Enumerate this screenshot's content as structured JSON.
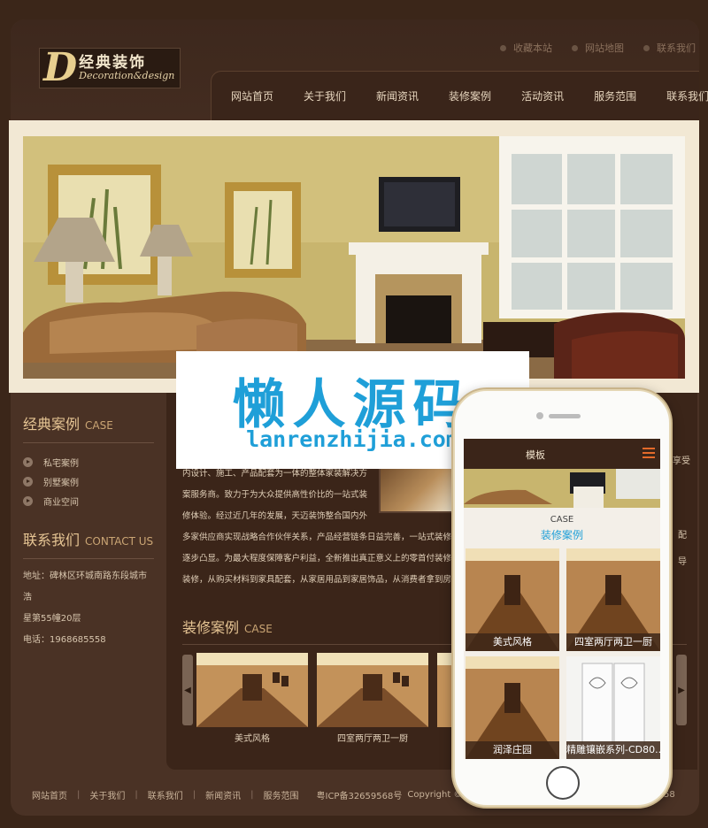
{
  "logo": {
    "letter": "D",
    "cn": "经典装饰",
    "en": "Decoration&design"
  },
  "toplinks": [
    "收藏本站",
    "网站地图",
    "联系我们"
  ],
  "nav": [
    "网站首页",
    "关于我们",
    "新闻资讯",
    "装修案例",
    "活动资讯",
    "服务范围",
    "联系我们"
  ],
  "sidebar": {
    "case_title": "经典案例",
    "case_title_en": "CASE",
    "case_items": [
      "私宅案例",
      "别墅案例",
      "商业空间"
    ],
    "contact_title": "联系我们",
    "contact_title_en": "CONTACT US",
    "address_line1": "地址：碑林区环城南路东段城市浩",
    "address_line2": "星第55幢20层",
    "phone": "电话：1968685558"
  },
  "about": {
    "line1": "内设计、施工、产品配套为一体的整体家装解决方",
    "line2": "案服务商。致力于为大众提供高性价比的一站式装",
    "line3": "修体验。经过近几年的发展，天迈装饰整合国内外",
    "line4": "多家供应商实现战略合作伙伴关系，产品经营链条日益完善，一站式装修",
    "line5": "逐步凸显。为最大程度保障客户利益，全新推出真正意义上的零首付装修",
    "line6": "装修，从购买材料到家具配套，从家居用品到家居饰品，从消费者拿到房子"
  },
  "cases": {
    "title": "装修案例",
    "title_en": "CASE",
    "items": [
      "美式风格",
      "四室两厅两卫一厨"
    ]
  },
  "right_fragments": [
    "享受",
    "配",
    "导"
  ],
  "footer": {
    "links": [
      "网站首页",
      "关于我们",
      "联系我们",
      "新闻资讯",
      "服务范围"
    ],
    "icp": "粤ICP备32659568号",
    "copyright": "Copyright © 2002-20",
    "tail": "58"
  },
  "watermark": {
    "cn": "懒人源码",
    "en": "lanrenzhijia.com"
  },
  "phone": {
    "header_title": "模板",
    "case_en": "CASE",
    "case_cn": "装修案例",
    "tiles": [
      "美式风格",
      "四室两厅两卫一厨",
      "润泽庄园",
      "精雕镶嵌系列-CD80..."
    ]
  },
  "colors": {
    "accent_blue": "#1f9fd8",
    "menu_orange": "#e46a2a",
    "brown_dark": "#3b2519",
    "gold": "#e6c594"
  }
}
